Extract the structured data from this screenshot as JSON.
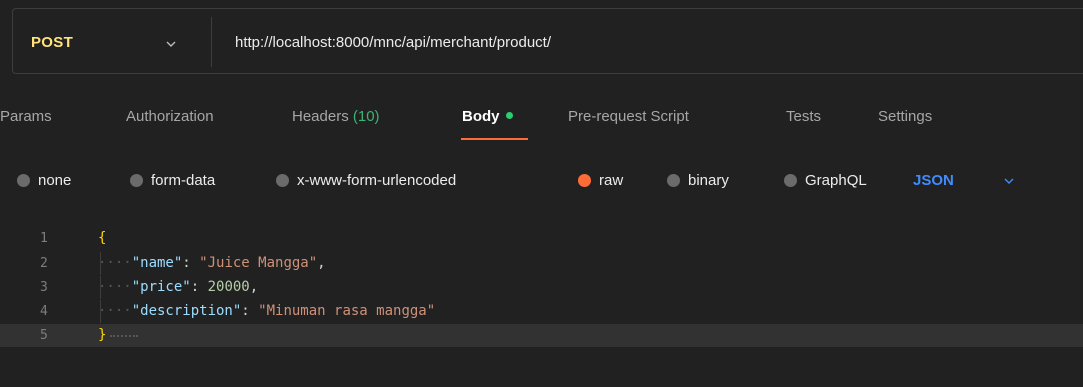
{
  "request": {
    "method": "POST",
    "url": "http://localhost:8000/mnc/api/merchant/product/"
  },
  "tabs": [
    {
      "label": "Params"
    },
    {
      "label": "Authorization"
    },
    {
      "label": "Headers",
      "count": "(10)"
    },
    {
      "label": "Body"
    },
    {
      "label": "Pre-request Script"
    },
    {
      "label": "Tests"
    },
    {
      "label": "Settings"
    }
  ],
  "body_types": [
    {
      "label": "none",
      "selected": false
    },
    {
      "label": "form-data",
      "selected": false
    },
    {
      "label": "x-www-form-urlencoded",
      "selected": false
    },
    {
      "label": "raw",
      "selected": true
    },
    {
      "label": "binary",
      "selected": false
    },
    {
      "label": "GraphQL",
      "selected": false
    }
  ],
  "format": "JSON",
  "editor": {
    "line_numbers": [
      "1",
      "2",
      "3",
      "4",
      "5"
    ],
    "lines": [
      {
        "open": "{"
      },
      {
        "key": "\"name\"",
        "sep": ": ",
        "value": "\"Juice Mangga\"",
        "end": ","
      },
      {
        "key": "\"price\"",
        "sep": ": ",
        "value": "20000",
        "end": ","
      },
      {
        "key": "\"description\"",
        "sep": ": ",
        "value": "\"Minuman rasa mangga\"",
        "end": ""
      },
      {
        "close": "}"
      }
    ]
  },
  "colors": {
    "accent": "#ff6c37",
    "method": "#ffe47e",
    "json_link": "#3f8cff",
    "body_dot": "#2ecc71"
  }
}
